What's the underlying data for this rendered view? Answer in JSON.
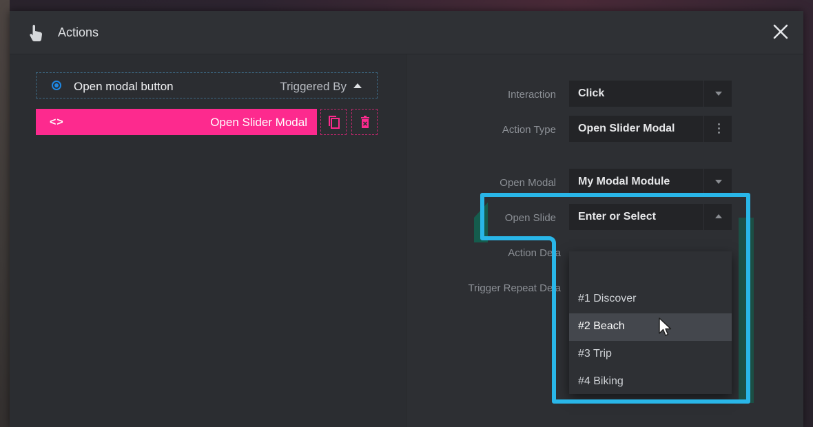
{
  "modal": {
    "title": "Actions",
    "icons": {
      "title": "hand-pointer-icon",
      "close": "close-icon"
    }
  },
  "trigger": {
    "label": "Open modal button",
    "triggered_by": "Triggered By",
    "selected": true
  },
  "action": {
    "label": "Open Slider Modal",
    "icons": {
      "type": "code-icon",
      "copy": "copy-icon",
      "delete": "trash-icon"
    }
  },
  "form": {
    "interaction": {
      "label": "Interaction",
      "value": "Click"
    },
    "action_type": {
      "label": "Action Type",
      "value": "Open Slider Modal"
    },
    "open_modal": {
      "label": "Open Modal",
      "value": "My Modal Module"
    },
    "open_slide": {
      "label": "Open Slide",
      "value": "Enter or Select"
    },
    "action_delay": {
      "label": "Action Dela"
    },
    "trigger_repeat_delay": {
      "label": "Trigger Repeat Dela"
    }
  },
  "dropdown": {
    "options": [
      {
        "label": "#1 Discover"
      },
      {
        "label": "#2 Beach",
        "hovered": true
      },
      {
        "label": "#3 Trip"
      },
      {
        "label": "#4 Biking"
      }
    ]
  },
  "colors": {
    "accent_pink": "#fd2a8e",
    "radio_blue": "#1e88e5",
    "highlight_cyan": "#29b6e8",
    "panel": "#2b2d31"
  }
}
